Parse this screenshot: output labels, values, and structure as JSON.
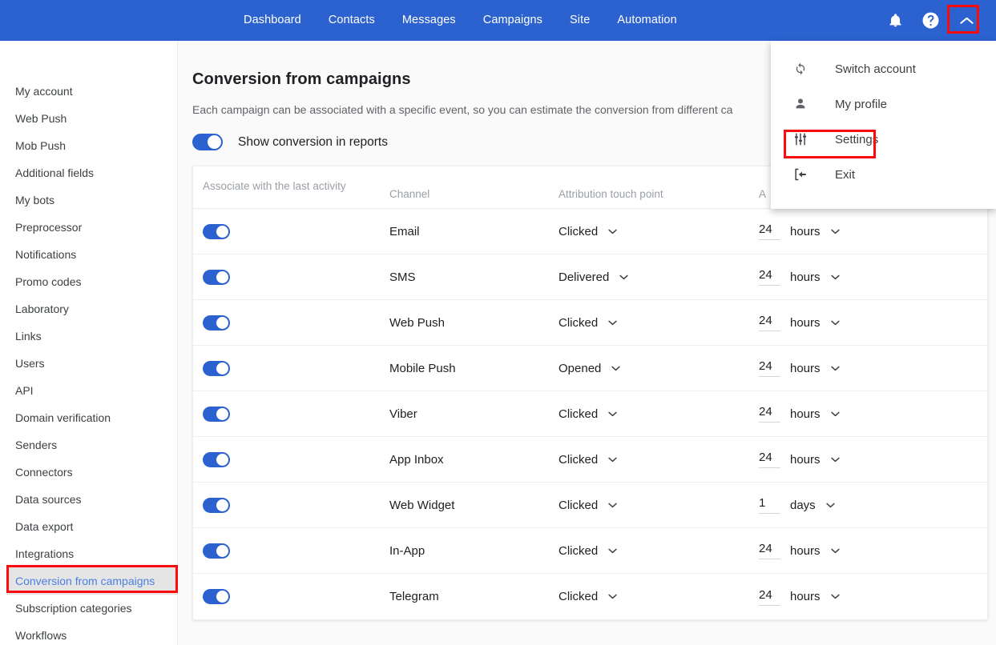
{
  "topnav": {
    "bg": "#2b62d0",
    "links": [
      {
        "label": "Dashboard"
      },
      {
        "label": "Contacts"
      },
      {
        "label": "Messages"
      },
      {
        "label": "Campaigns"
      },
      {
        "label": "Site"
      },
      {
        "label": "Automation"
      }
    ],
    "icons": [
      {
        "name": "bell-icon"
      },
      {
        "name": "help-circle-icon"
      },
      {
        "name": "chevron-up-icon"
      }
    ]
  },
  "account_menu": {
    "items": [
      {
        "label": "Switch account",
        "icon": "sync-icon"
      },
      {
        "label": "My profile",
        "icon": "person-icon"
      },
      {
        "label": "Settings",
        "icon": "sliders-icon",
        "highlighted": true
      },
      {
        "label": "Exit",
        "icon": "exit-icon"
      }
    ]
  },
  "highlight_color": "#fb0b0b",
  "sidebar": {
    "items": [
      {
        "label": "My account",
        "active": false
      },
      {
        "label": "Web Push",
        "active": false
      },
      {
        "label": "Mob Push",
        "active": false
      },
      {
        "label": "Additional fields",
        "active": false
      },
      {
        "label": "My bots",
        "active": false
      },
      {
        "label": "Preprocessor",
        "active": false
      },
      {
        "label": "Notifications",
        "active": false
      },
      {
        "label": "Promo codes",
        "active": false
      },
      {
        "label": "Laboratory",
        "active": false
      },
      {
        "label": "Links",
        "active": false
      },
      {
        "label": "Users",
        "active": false
      },
      {
        "label": "API",
        "active": false
      },
      {
        "label": "Domain verification",
        "active": false
      },
      {
        "label": "Senders",
        "active": false
      },
      {
        "label": "Connectors",
        "active": false
      },
      {
        "label": "Data sources",
        "active": false
      },
      {
        "label": "Data export",
        "active": false
      },
      {
        "label": "Integrations",
        "active": false
      },
      {
        "label": "Conversion from campaigns",
        "active": true
      },
      {
        "label": "Subscription categories",
        "active": false
      },
      {
        "label": "Workflows",
        "active": false
      }
    ]
  },
  "main": {
    "title": "Conversion from campaigns",
    "description": "Each campaign can be associated with a specific event, so you can estimate the conversion from different ca",
    "show_conversion_toggle": {
      "label": "Show conversion in reports",
      "on": true
    },
    "table": {
      "headers": {
        "c1": "Associate with the last activity",
        "c2": "Channel",
        "c3": "Attribution touch point",
        "c4": "A"
      },
      "rows": [
        {
          "enabled": true,
          "channel": "Email",
          "touch_point": "Clicked",
          "amount": "24",
          "unit": "hours"
        },
        {
          "enabled": true,
          "channel": "SMS",
          "touch_point": "Delivered",
          "amount": "24",
          "unit": "hours"
        },
        {
          "enabled": true,
          "channel": "Web Push",
          "touch_point": "Clicked",
          "amount": "24",
          "unit": "hours"
        },
        {
          "enabled": true,
          "channel": "Mobile Push",
          "touch_point": "Opened",
          "amount": "24",
          "unit": "hours"
        },
        {
          "enabled": true,
          "channel": "Viber",
          "touch_point": "Clicked",
          "amount": "24",
          "unit": "hours"
        },
        {
          "enabled": true,
          "channel": "App Inbox",
          "touch_point": "Clicked",
          "amount": "24",
          "unit": "hours"
        },
        {
          "enabled": true,
          "channel": "Web Widget",
          "touch_point": "Clicked",
          "amount": "1",
          "unit": "days"
        },
        {
          "enabled": true,
          "channel": "In-App",
          "touch_point": "Clicked",
          "amount": "24",
          "unit": "hours"
        },
        {
          "enabled": true,
          "channel": "Telegram",
          "touch_point": "Clicked",
          "amount": "24",
          "unit": "hours"
        }
      ]
    }
  }
}
